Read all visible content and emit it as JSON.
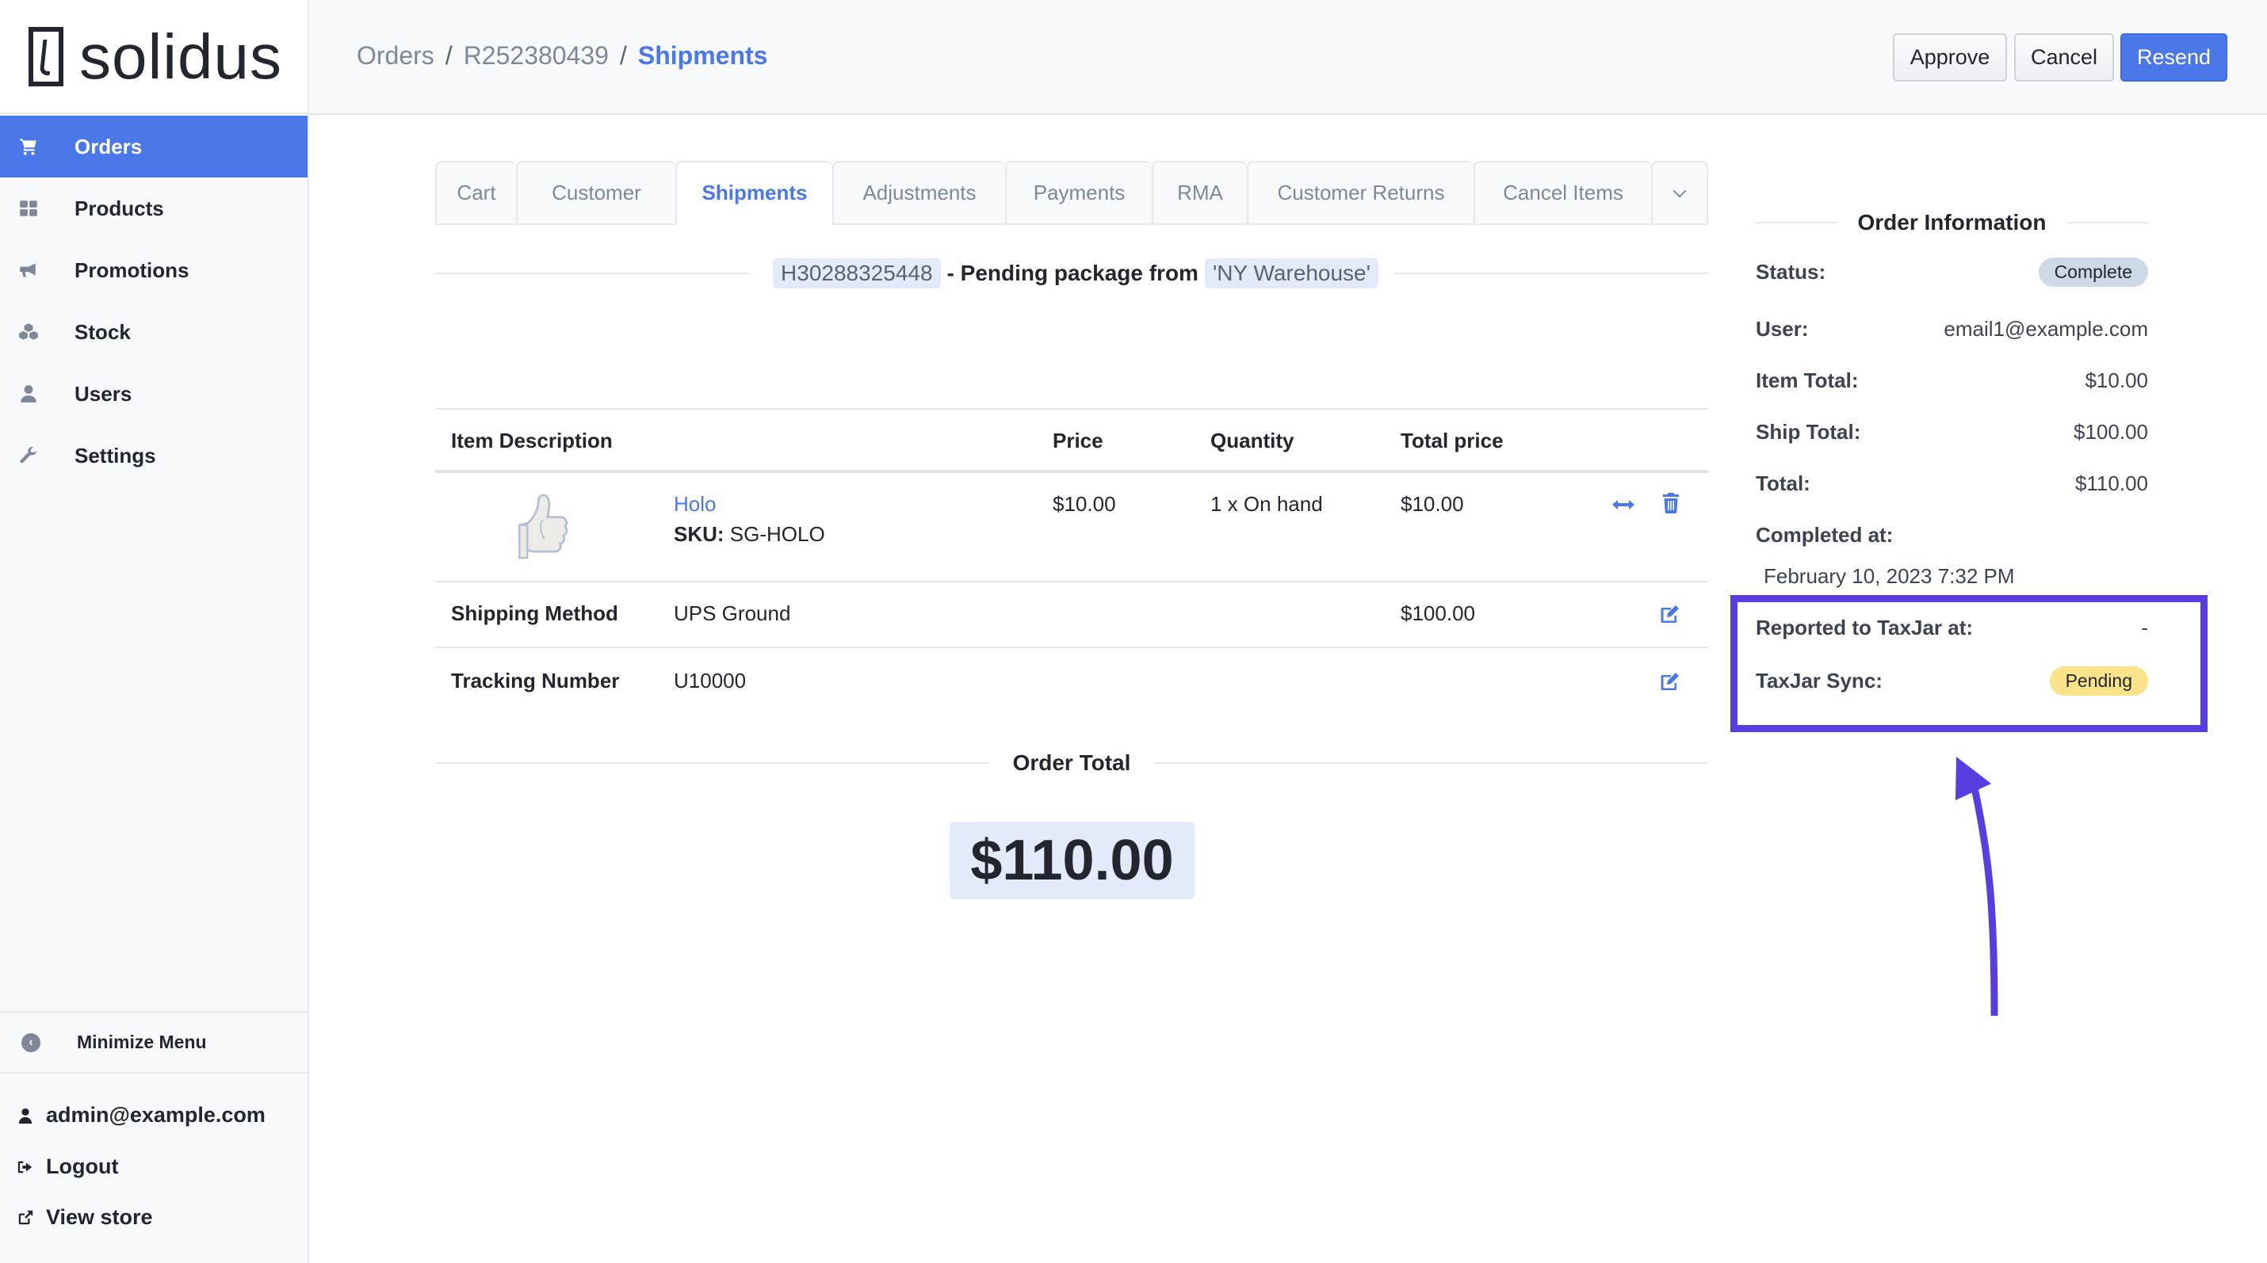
{
  "brand": {
    "name": "solidus"
  },
  "sidebar": {
    "items": [
      {
        "label": "Orders",
        "icon": "cart-icon",
        "active": true
      },
      {
        "label": "Products",
        "icon": "grid-icon",
        "active": false
      },
      {
        "label": "Promotions",
        "icon": "megaphone-icon",
        "active": false
      },
      {
        "label": "Stock",
        "icon": "cubes-icon",
        "active": false
      },
      {
        "label": "Users",
        "icon": "user-icon",
        "active": false
      },
      {
        "label": "Settings",
        "icon": "wrench-icon",
        "active": false
      }
    ],
    "minimize_label": "Minimize Menu",
    "account": {
      "email": "admin@example.com",
      "logout": "Logout",
      "view_store": "View store"
    }
  },
  "header": {
    "breadcrumb": [
      "Orders",
      "R252380439",
      "Shipments"
    ],
    "separator": "/",
    "buttons": {
      "approve": "Approve",
      "cancel": "Cancel",
      "resend": "Resend"
    }
  },
  "tabs": [
    {
      "label": "Cart",
      "active": false
    },
    {
      "label": "Customer",
      "active": false
    },
    {
      "label": "Shipments",
      "active": true
    },
    {
      "label": "Adjustments",
      "active": false
    },
    {
      "label": "Payments",
      "active": false
    },
    {
      "label": "RMA",
      "active": false
    },
    {
      "label": "Customer Returns",
      "active": false
    },
    {
      "label": "Cancel Items",
      "active": false
    }
  ],
  "shipment": {
    "number": "H30288325448",
    "middle_text": "- Pending package from",
    "location": "'NY Warehouse'",
    "table": {
      "headers": [
        "Item Description",
        "Price",
        "Quantity",
        "Total price"
      ],
      "items": [
        {
          "name": "Holo",
          "sku_label": "SKU:",
          "sku": "SG-HOLO",
          "price": "$10.00",
          "quantity": "1 x On hand",
          "total": "$10.00"
        }
      ],
      "shipping_method": {
        "label": "Shipping Method",
        "value": "UPS Ground",
        "cost": "$100.00"
      },
      "tracking": {
        "label": "Tracking Number",
        "value": "U10000"
      }
    }
  },
  "order_total": {
    "label": "Order Total",
    "value": "$110.00"
  },
  "order_info": {
    "title": "Order Information",
    "status_label": "Status:",
    "status": "Complete",
    "user_label": "User:",
    "user": "email1@example.com",
    "item_total_label": "Item Total:",
    "item_total": "$10.00",
    "ship_total_label": "Ship Total:",
    "ship_total": "$100.00",
    "total_label": "Total:",
    "total": "$110.00",
    "completed_label": "Completed at:",
    "completed": "February 10, 2023 7:32 PM",
    "reported_label": "Reported to TaxJar at:",
    "reported": "-",
    "sync_label": "TaxJar Sync:",
    "sync": "Pending"
  },
  "colors": {
    "accent": "#4a78e8",
    "annotation": "#5a3de0",
    "pending": "#fbe38a",
    "complete": "#cdd9e6"
  }
}
